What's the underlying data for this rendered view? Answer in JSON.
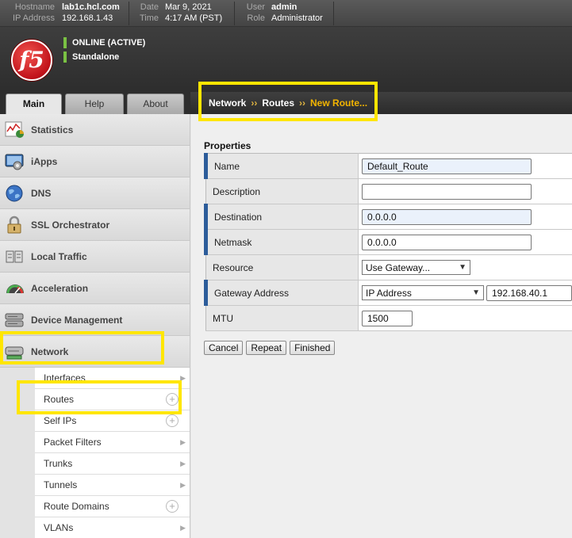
{
  "topbar": {
    "hostname_label": "Hostname",
    "hostname": "lab1c.hcl.com",
    "ip_label": "IP Address",
    "ip": "192.168.1.43",
    "date_label": "Date",
    "date": "Mar 9, 2021",
    "time_label": "Time",
    "time": "4:17 AM (PST)",
    "user_label": "User",
    "user": "admin",
    "role_label": "Role",
    "role": "Administrator"
  },
  "header": {
    "logo_text": "f5",
    "status_online": "ONLINE (ACTIVE)",
    "status_mode": "Standalone",
    "status_color": "#7ac143"
  },
  "tabs": [
    {
      "label": "Main",
      "active": true
    },
    {
      "label": "Help",
      "active": false
    },
    {
      "label": "About",
      "active": false
    }
  ],
  "breadcrumb": {
    "network": "Network",
    "routes": "Routes",
    "current": "New Route...",
    "separator": "››"
  },
  "sidebar": {
    "items": [
      {
        "label": "Statistics",
        "icon": "statistics-icon"
      },
      {
        "label": "iApps",
        "icon": "iapps-icon"
      },
      {
        "label": "DNS",
        "icon": "dns-globe-icon"
      },
      {
        "label": "SSL Orchestrator",
        "icon": "lock-icon"
      },
      {
        "label": "Local Traffic",
        "icon": "local-traffic-icon"
      },
      {
        "label": "Acceleration",
        "icon": "speedometer-icon"
      },
      {
        "label": "Device Management",
        "icon": "device-icon"
      },
      {
        "label": "Network",
        "icon": "network-icon"
      }
    ],
    "network_subitems": [
      {
        "label": "Interfaces",
        "control": "arrow"
      },
      {
        "label": "Routes",
        "control": "plus"
      },
      {
        "label": "Self IPs",
        "control": "plus"
      },
      {
        "label": "Packet Filters",
        "control": "arrow"
      },
      {
        "label": "Trunks",
        "control": "arrow"
      },
      {
        "label": "Tunnels",
        "control": "arrow"
      },
      {
        "label": "Route Domains",
        "control": "plus"
      },
      {
        "label": "VLANs",
        "control": "arrow"
      }
    ]
  },
  "form": {
    "section_title": "Properties",
    "name_label": "Name",
    "name_value": "Default_Route",
    "description_label": "Description",
    "description_value": "",
    "destination_label": "Destination",
    "destination_value": "0.0.0.0",
    "netmask_label": "Netmask",
    "netmask_value": "0.0.0.0",
    "resource_label": "Resource",
    "resource_value": "Use Gateway...",
    "gateway_label": "Gateway Address",
    "gateway_type": "IP Address",
    "gateway_value": "192.168.40.1",
    "mtu_label": "MTU",
    "mtu_value": "1500"
  },
  "buttons": {
    "cancel": "Cancel",
    "repeat": "Repeat",
    "finished": "Finished"
  },
  "colors": {
    "highlight": "#ffe600",
    "required_marker": "#2c5c9a",
    "crumb_current": "#f2b400"
  }
}
